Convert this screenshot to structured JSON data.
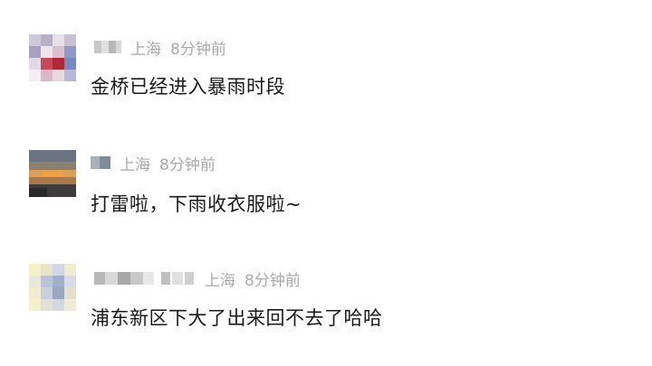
{
  "comments": [
    {
      "location": "上海",
      "time": "8分钟前",
      "text": "金桥已经进入暴雨时段",
      "avatar_colors": [
        "#c8c2d8",
        "#e8d8e0",
        "#b02838",
        "#7888c0"
      ]
    },
    {
      "location": "上海",
      "time": "8分钟前",
      "text": "打雷啦，下雨收衣服啦~",
      "avatar_colors": [
        "#5a6878",
        "#c89858",
        "#e08838",
        "#3a3a40"
      ]
    },
    {
      "location": "上海",
      "time": "8分钟前",
      "text": "浦东新区下大了出来回不去了哈哈",
      "avatar_colors": [
        "#f0ecc0",
        "#c8d0e8",
        "#a8b8c8",
        "#e8e4d0"
      ]
    }
  ]
}
